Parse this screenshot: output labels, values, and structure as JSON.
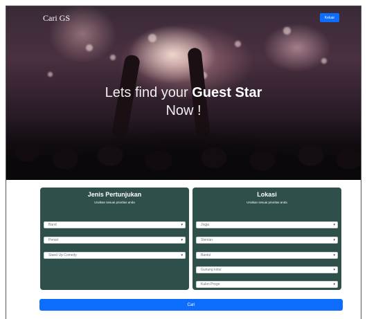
{
  "navbar": {
    "brand": "Cari GS",
    "logout_label": "Keluar"
  },
  "hero": {
    "headline_prefix": "Lets find your ",
    "headline_strong": "Guest Star",
    "headline_line2": "Now !"
  },
  "jenis": {
    "title": "Jenis Pertunjukan",
    "subtitle": "Urutkan sesuai prioritas anda",
    "selects": [
      "Band",
      "Penari",
      "Stand Up Comedy"
    ]
  },
  "lokasi": {
    "title": "Lokasi",
    "subtitle": "Urutkan sesuai prioritas anda",
    "selects": [
      "Jogja",
      "Sleman",
      "Bantul",
      "Gunung kidul",
      "Kulon Progo"
    ]
  },
  "search_label": "Cari",
  "colors": {
    "panel": "#2f504a",
    "primary": "#0d6efd"
  },
  "icons": {
    "select_chevron": "chevron-down-icon"
  }
}
